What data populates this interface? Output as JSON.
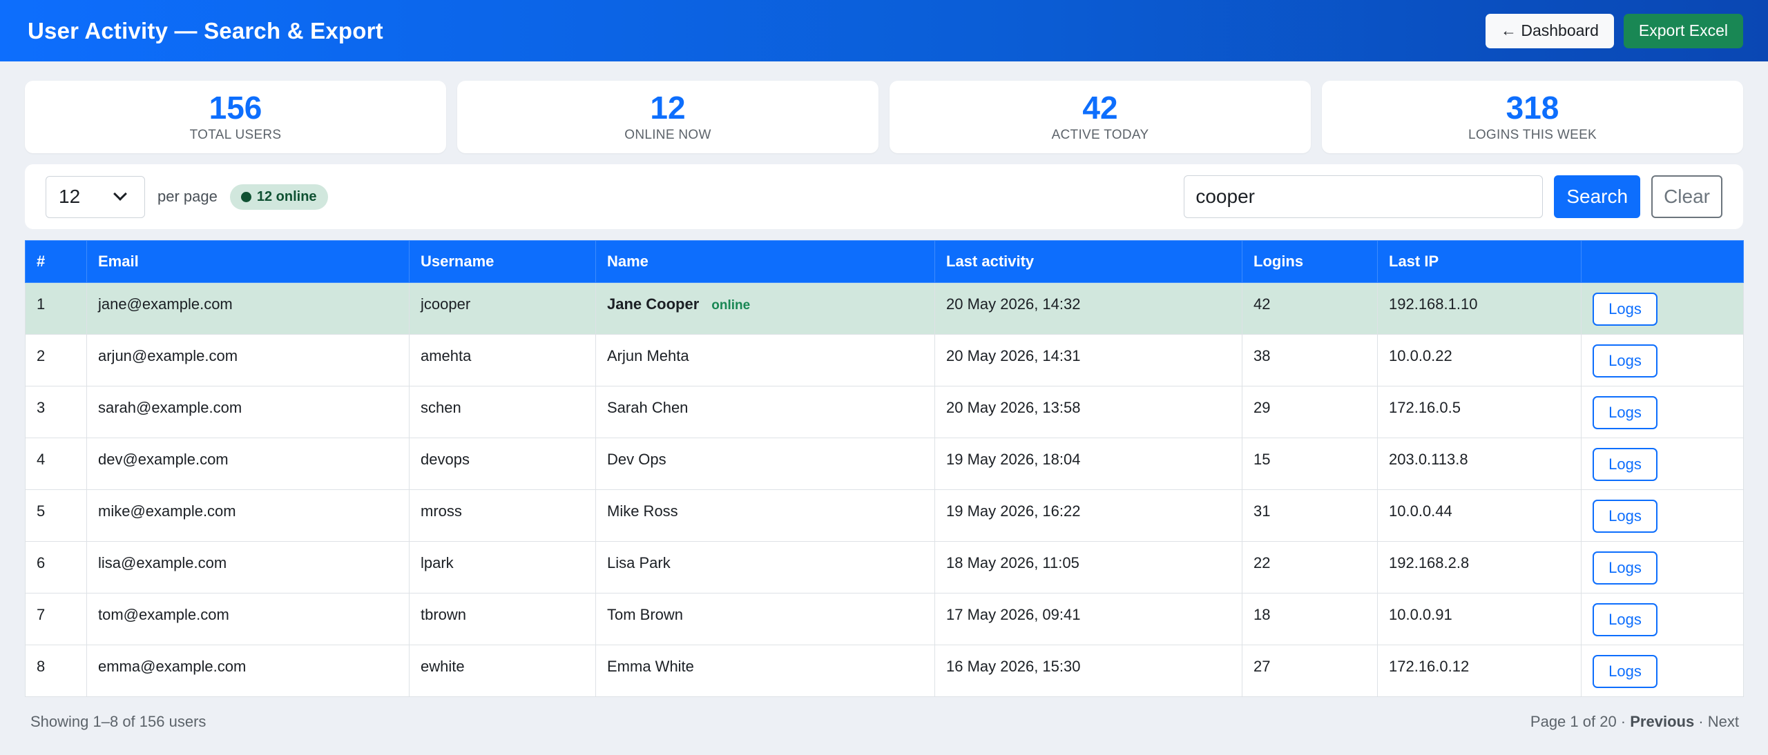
{
  "header": {
    "title": "User Activity — Search & Export",
    "dashboard_label": "← Dashboard",
    "export_label": "Export Excel"
  },
  "stats": [
    {
      "value": "156",
      "label": "TOTAL USERS"
    },
    {
      "value": "12",
      "label": "ONLINE NOW"
    },
    {
      "value": "42",
      "label": "ACTIVE TODAY"
    },
    {
      "value": "318",
      "label": "LOGINS THIS WEEK"
    }
  ],
  "toolbar": {
    "per_page_value": "12",
    "per_page_label": "per page",
    "online_badge": "12 online",
    "search_value": "cooper",
    "search_label": "Search",
    "clear_label": "Clear"
  },
  "table": {
    "columns": [
      "#",
      "Email",
      "Username",
      "Name",
      "Last activity",
      "Logins",
      "Last IP",
      ""
    ],
    "rows": [
      {
        "n": "1",
        "email": "jane@example.com",
        "username": "jcooper",
        "name": "Jane Cooper",
        "status": "online",
        "last": "20 May 2026, 14:32",
        "logins": "42",
        "ip": "192.168.1.10",
        "action": "Logs"
      },
      {
        "n": "2",
        "email": "arjun@example.com",
        "username": "amehta",
        "name": "Arjun Mehta",
        "status": "",
        "last": "20 May 2026, 14:31",
        "logins": "38",
        "ip": "10.0.0.22",
        "action": "Logs"
      },
      {
        "n": "3",
        "email": "sarah@example.com",
        "username": "schen",
        "name": "Sarah Chen",
        "status": "",
        "last": "20 May 2026, 13:58",
        "logins": "29",
        "ip": "172.16.0.5",
        "action": "Logs"
      },
      {
        "n": "4",
        "email": "dev@example.com",
        "username": "devops",
        "name": "Dev Ops",
        "status": "",
        "last": "19 May 2026, 18:04",
        "logins": "15",
        "ip": "203.0.113.8",
        "action": "Logs"
      },
      {
        "n": "5",
        "email": "mike@example.com",
        "username": "mross",
        "name": "Mike Ross",
        "status": "",
        "last": "19 May 2026, 16:22",
        "logins": "31",
        "ip": "10.0.0.44",
        "action": "Logs"
      },
      {
        "n": "6",
        "email": "lisa@example.com",
        "username": "lpark",
        "name": "Lisa Park",
        "status": "",
        "last": "18 May 2026, 11:05",
        "logins": "22",
        "ip": "192.168.2.8",
        "action": "Logs"
      },
      {
        "n": "7",
        "email": "tom@example.com",
        "username": "tbrown",
        "name": "Tom Brown",
        "status": "",
        "last": "17 May 2026, 09:41",
        "logins": "18",
        "ip": "10.0.0.91",
        "action": "Logs"
      },
      {
        "n": "8",
        "email": "emma@example.com",
        "username": "ewhite",
        "name": "Emma White",
        "status": "",
        "last": "16 May 2026, 15:30",
        "logins": "27",
        "ip": "172.16.0.12",
        "action": "Logs"
      }
    ]
  },
  "footer": {
    "showing": "Showing 1–8 of 156 users",
    "page": "Page 1 of 20",
    "sep1": " · ",
    "previous": "Previous",
    "sep2": " · ",
    "next": "Next"
  }
}
